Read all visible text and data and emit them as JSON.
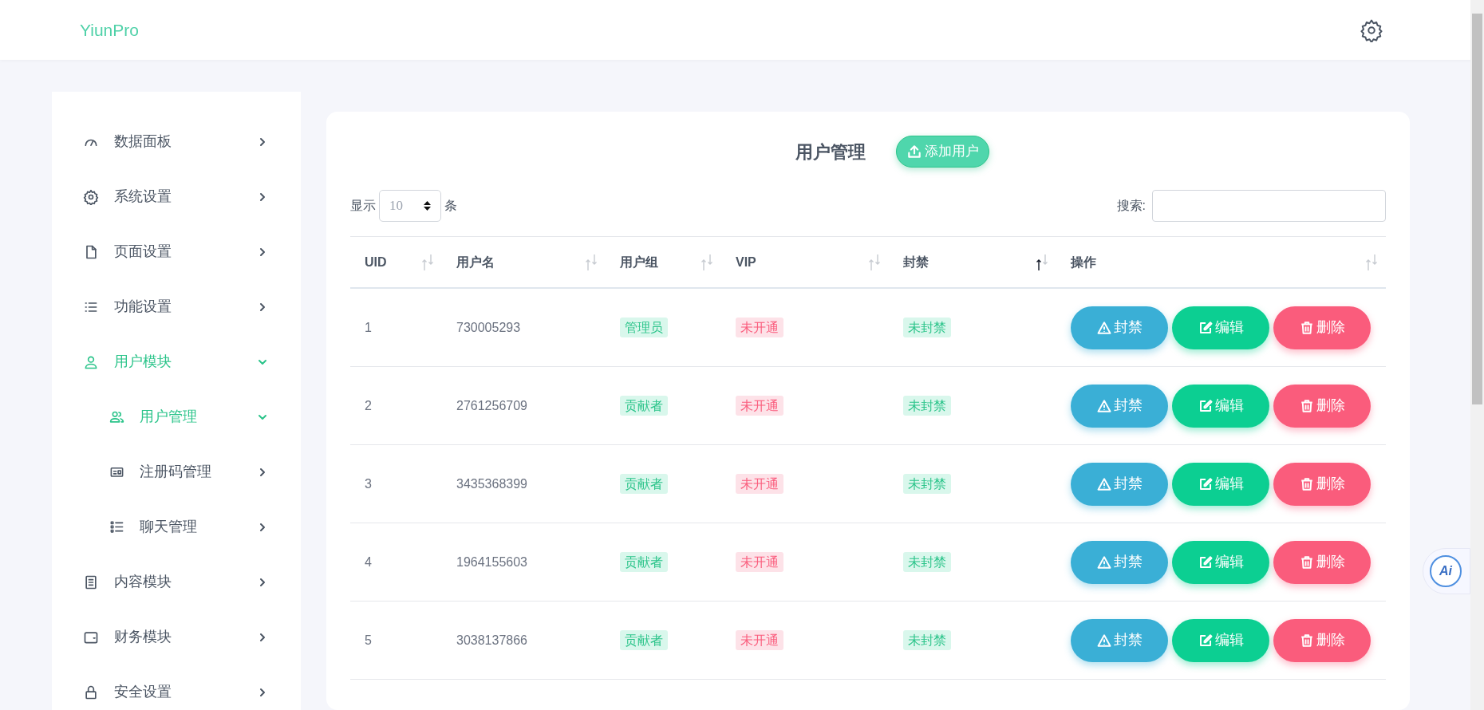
{
  "header": {
    "logo": "YiunPro"
  },
  "sidebar": {
    "items": [
      {
        "label": "数据面板",
        "selected": false,
        "expanded": false
      },
      {
        "label": "系统设置",
        "selected": false,
        "expanded": false
      },
      {
        "label": "页面设置",
        "selected": false,
        "expanded": false
      },
      {
        "label": "功能设置",
        "selected": false,
        "expanded": false
      },
      {
        "label": "用户模块",
        "selected": true,
        "expanded": true,
        "children": [
          {
            "label": "用户管理",
            "selected": true,
            "expanded": true
          },
          {
            "label": "注册码管理",
            "selected": false,
            "expanded": false
          },
          {
            "label": "聊天管理",
            "selected": false,
            "expanded": false
          }
        ]
      },
      {
        "label": "内容模块",
        "selected": false,
        "expanded": false
      },
      {
        "label": "财务模块",
        "selected": false,
        "expanded": false
      },
      {
        "label": "安全设置",
        "selected": false,
        "expanded": false
      }
    ]
  },
  "panel": {
    "title": "用户管理",
    "add_button": "添加用户",
    "length": {
      "prefix": "显示",
      "value": "10",
      "suffix": "条"
    },
    "search": {
      "label": "搜索:"
    },
    "table": {
      "columns": [
        {
          "label": "UID",
          "sorted": false
        },
        {
          "label": "用户名",
          "sorted": false
        },
        {
          "label": "用户组",
          "sorted": false
        },
        {
          "label": "VIP",
          "sorted": false
        },
        {
          "label": "封禁",
          "sorted": true
        },
        {
          "label": "操作",
          "sorted": false
        }
      ],
      "rows": [
        {
          "uid": "1",
          "username": "730005293",
          "group": "管理员",
          "vip": "未开通",
          "banned": "未封禁",
          "actions": [
            "封禁",
            "编辑",
            "删除"
          ]
        },
        {
          "uid": "2",
          "username": "2761256709",
          "group": "贡献者",
          "vip": "未开通",
          "banned": "未封禁",
          "actions": [
            "封禁",
            "编辑",
            "删除"
          ]
        },
        {
          "uid": "3",
          "username": "3435368399",
          "group": "贡献者",
          "vip": "未开通",
          "banned": "未封禁",
          "actions": [
            "封禁",
            "编辑",
            "删除"
          ]
        },
        {
          "uid": "4",
          "username": "1964155603",
          "group": "贡献者",
          "vip": "未开通",
          "banned": "未封禁",
          "actions": [
            "封禁",
            "编辑",
            "删除"
          ]
        },
        {
          "uid": "5",
          "username": "3038137866",
          "group": "贡献者",
          "vip": "未开通",
          "banned": "未封禁",
          "actions": [
            "封禁",
            "编辑",
            "删除"
          ]
        }
      ]
    }
  },
  "ai_button": {
    "label": "Ai"
  }
}
